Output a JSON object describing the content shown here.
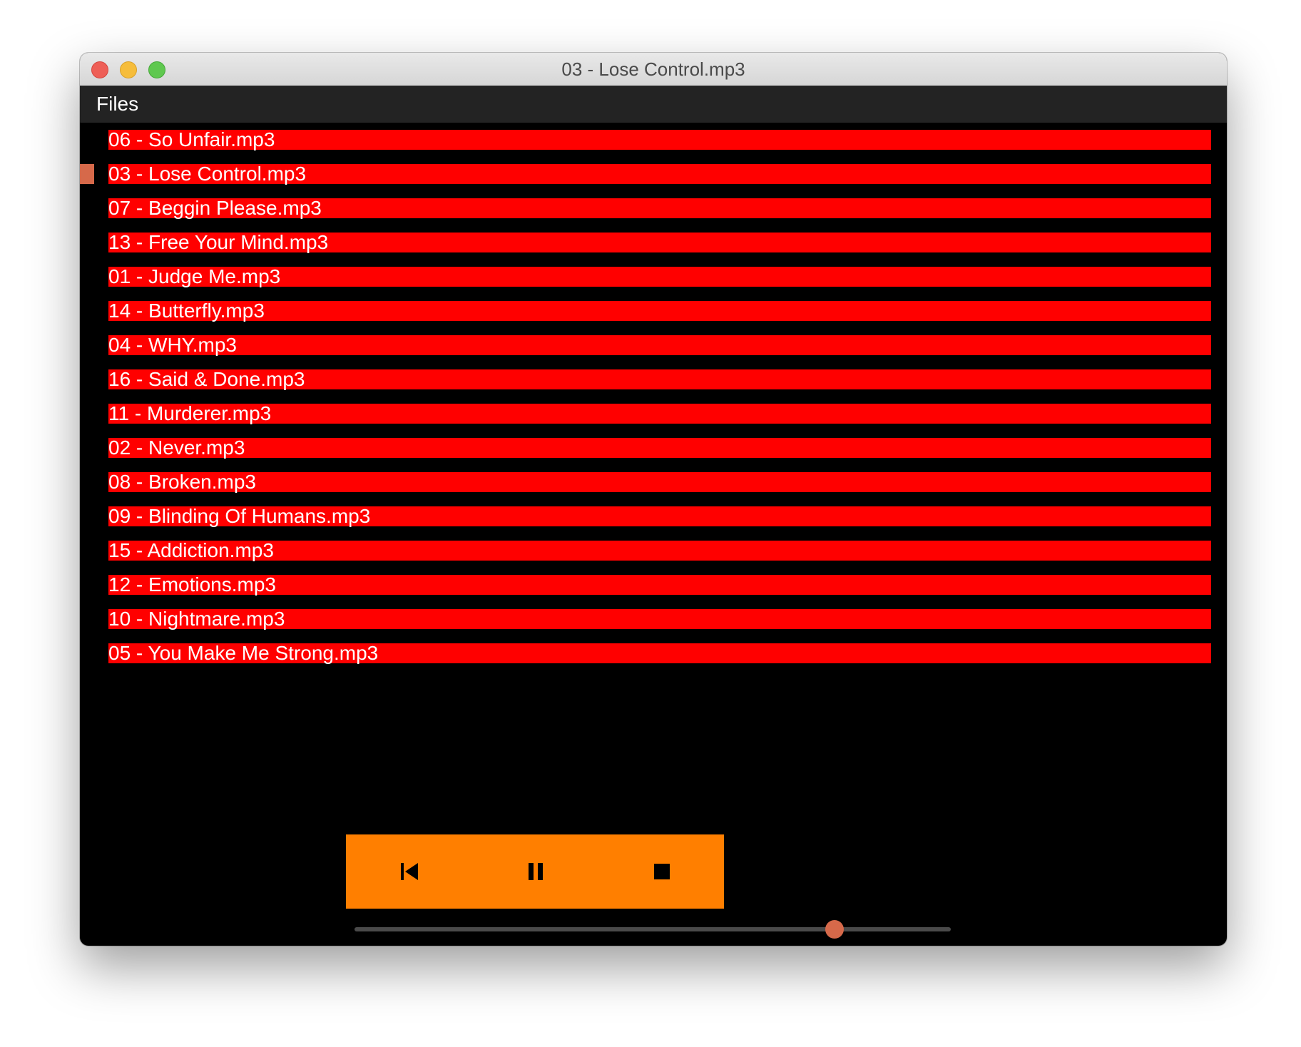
{
  "window": {
    "title": "03 - Lose Control.mp3"
  },
  "menubar": {
    "files_label": "Files"
  },
  "playlist": {
    "current_index": 1,
    "tracks": [
      "06 - So Unfair.mp3",
      "03 - Lose Control.mp3",
      "07 - Beggin Please.mp3",
      "13 - Free Your Mind.mp3",
      "01 - Judge Me.mp3",
      "14 - Butterfly.mp3",
      "04 - WHY.mp3",
      "16 - Said & Done.mp3",
      "11 - Murderer.mp3",
      "02 - Never.mp3",
      "08 - Broken.mp3",
      "09 - Blinding Of Humans.mp3",
      "15 - Addiction.mp3",
      "12 - Emotions.mp3",
      "10 - Nightmare.mp3",
      "05 - You Make Me Strong.mp3"
    ]
  },
  "controls": {
    "buttons": [
      {
        "name": "previous-button",
        "icon": "skip-previous-icon"
      },
      {
        "name": "pause-button",
        "icon": "pause-icon"
      },
      {
        "name": "stop-button",
        "icon": "stop-icon"
      }
    ]
  },
  "slider": {
    "value": 0.805
  },
  "colors": {
    "track_bg": "#ff0000",
    "controls_bg": "#ff7f00",
    "accent": "#d6694a",
    "menubar_bg": "#232323",
    "window_bg": "#000000"
  }
}
